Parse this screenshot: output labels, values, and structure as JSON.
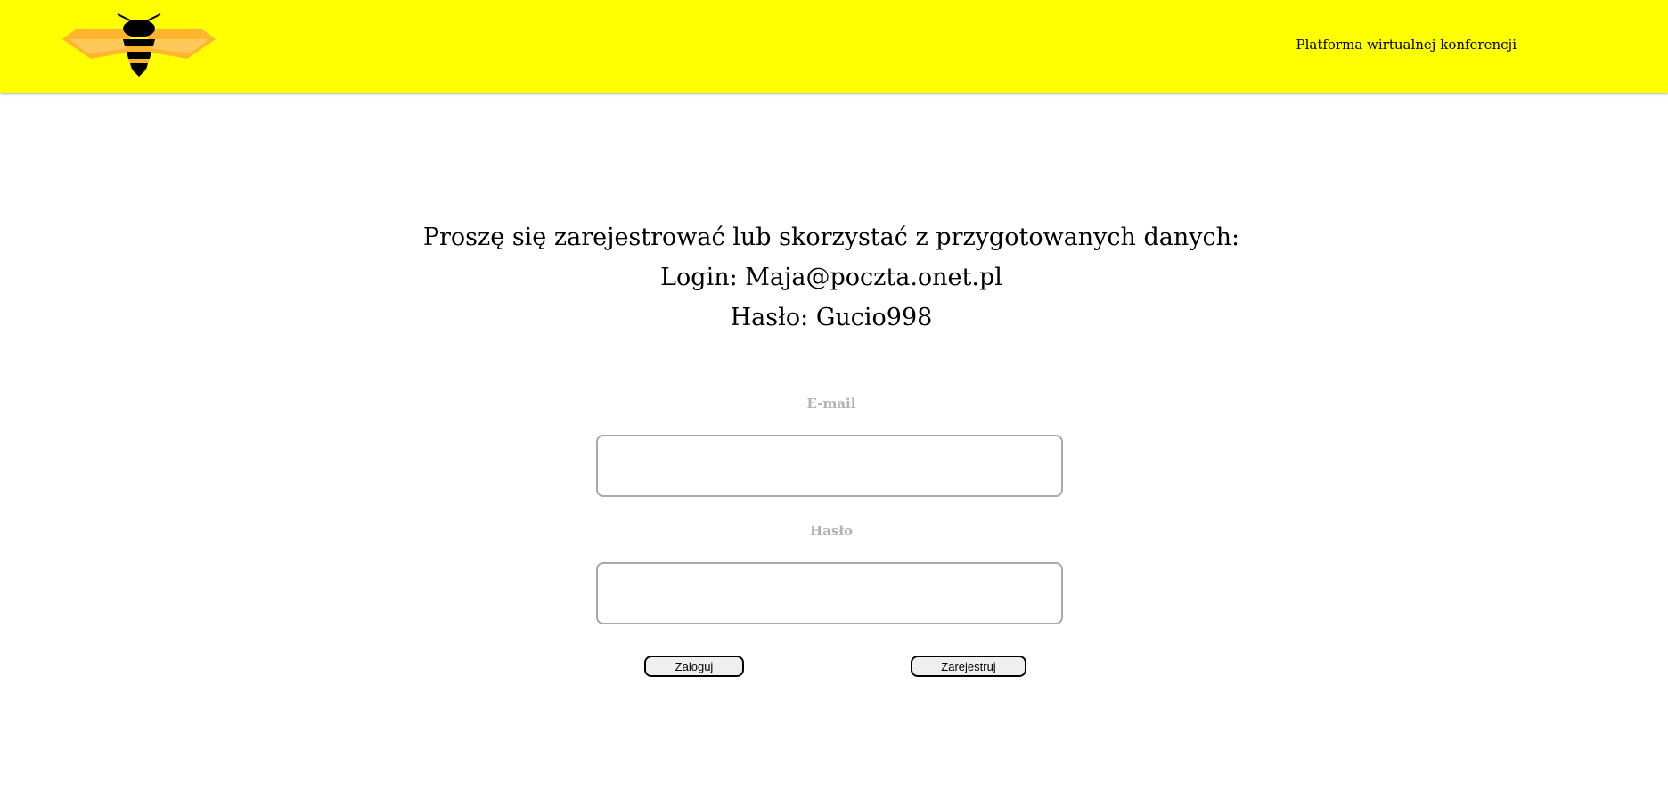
{
  "header": {
    "logo_icon": "bee-icon",
    "title": "Platforma wirtualnej konferencji",
    "background": "#ffff00"
  },
  "intro": {
    "line1": "Proszę się zarejestrować lub skorzystać z przygotowanych danych:",
    "line2": "Login: Maja@poczta.onet.pl",
    "line3": "Hasło: Gucio998"
  },
  "form": {
    "email_label": "E-mail",
    "email_value": "",
    "password_label": "Hasło",
    "password_value": "",
    "login_button": "Zaloguj",
    "register_button": "Zarejestruj"
  }
}
